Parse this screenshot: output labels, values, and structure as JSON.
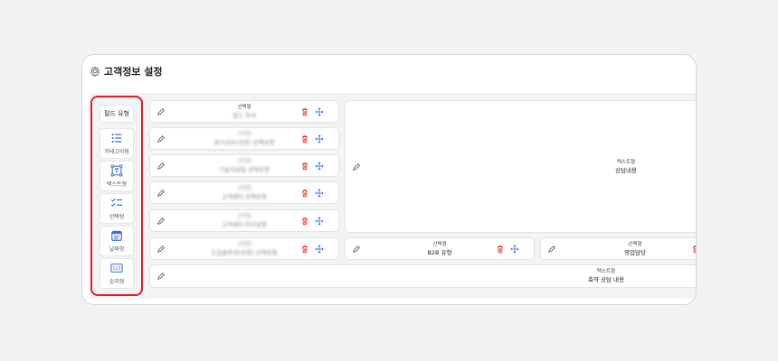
{
  "card": {
    "title": "고객정보 설정"
  },
  "palette": {
    "header": "필드 유형",
    "tools": [
      {
        "label": "카테고리형",
        "icon": "category-list-icon"
      },
      {
        "label": "텍스트형",
        "icon": "text-box-icon"
      },
      {
        "label": "선택형",
        "icon": "checklist-icon"
      },
      {
        "label": "날짜형",
        "icon": "calendar-icon"
      },
      {
        "label": "숫자형",
        "icon": "number-icon"
      }
    ]
  },
  "fields": {
    "f1": {
      "type": "선택형",
      "name": "필드 무서"
    },
    "f2": {
      "type": "선택형",
      "name": "회사규모(선정) 선택유형"
    },
    "f3": {
      "type": "선택형",
      "name": "기술지원팀 선택유형"
    },
    "f4": {
      "type": "선택형",
      "name": "고객센터 선택유형"
    },
    "f5": {
      "type": "선택형",
      "name": "고객센터 미지정형"
    },
    "f6": {
      "type": "선택형",
      "name": "도입솔루션(선정) 선택유형"
    },
    "f7": {
      "type": "선택형",
      "name": "B2B 유형"
    },
    "f8": {
      "type": "선택형",
      "name": "영업담당"
    },
    "f9": {
      "type": "텍스트형",
      "name": "상담내용"
    },
    "f10": {
      "type": "텍스트형",
      "name": "축약 상담 내용"
    }
  },
  "colors": {
    "accent_red": "#e31c25",
    "icon_blue": "#3b6fd8",
    "delete_red": "#e0443c"
  }
}
